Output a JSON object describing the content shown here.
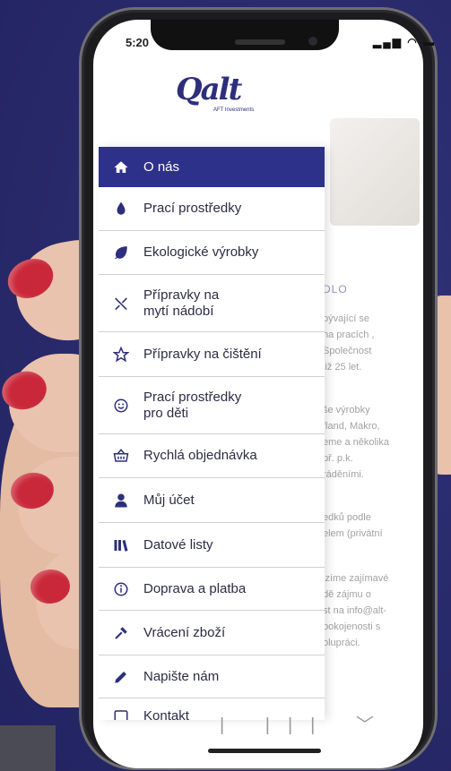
{
  "status_bar": {
    "time": "5:20",
    "icons": "▂▄▆ ◠ ▬"
  },
  "logo": {
    "text": "Qalt",
    "subtext": "AFT Investments"
  },
  "menu": {
    "items": [
      {
        "label": "O nás",
        "icon": "home-icon"
      },
      {
        "label": "Prací prostředky",
        "icon": "drop-icon"
      },
      {
        "label": "Ekologické výrobky",
        "icon": "leaf-icon"
      },
      {
        "label": "Přípravky na\nmytí nádobí",
        "icon": "cutlery-icon"
      },
      {
        "label": "Přípravky na čištění",
        "icon": "star-icon"
      },
      {
        "label": "Prací prostředky\npro děti",
        "icon": "smiley-icon"
      },
      {
        "label": "Rychlá objednávka",
        "icon": "basket-icon"
      },
      {
        "label": "Můj účet",
        "icon": "user-icon"
      },
      {
        "label": "Datové listy",
        "icon": "books-icon"
      },
      {
        "label": "Doprava a platba",
        "icon": "info-icon"
      },
      {
        "label": "Vrácení zboží",
        "icon": "tools-icon"
      },
      {
        "label": "Napište nám",
        "icon": "pencil-icon"
      },
      {
        "label": "Kontakt",
        "icon": "contact-icon"
      }
    ]
  },
  "background_page": {
    "heading": "DLO",
    "lines": [
      "bývající se",
      "na pracích ,",
      "Společnost",
      "již 25 let.",
      "še výrobky",
      "fland, Makro,",
      "eme a několika",
      "př. p.k.",
      "ráděními.",
      "edků podle",
      "elem (privátní",
      "izíme zajímavé",
      "dě zájmu o",
      "st na info@alt-",
      "pokojenosti s",
      "olupráci."
    ]
  },
  "bottom_nav": {
    "icons": "| ||| ﹀"
  }
}
